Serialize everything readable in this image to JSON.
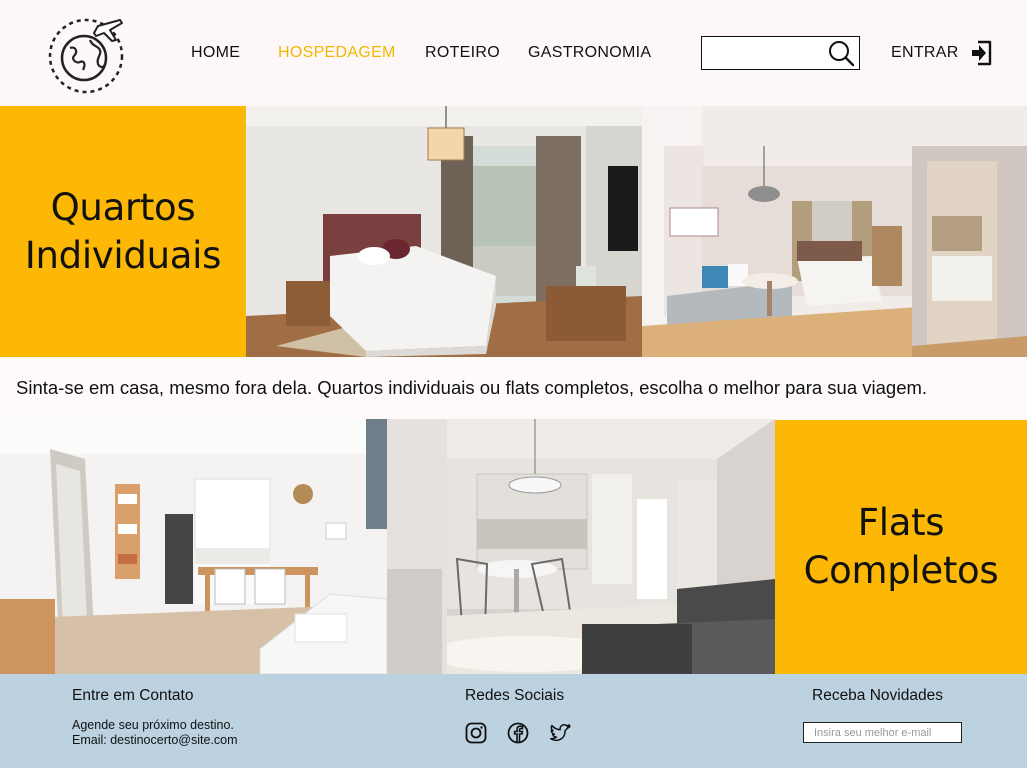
{
  "header": {
    "nav": [
      {
        "label": "HOME",
        "active": false
      },
      {
        "label": "HOSPEDAGEM",
        "active": true
      },
      {
        "label": "ROTEIRO",
        "active": false
      },
      {
        "label": "GASTRONOMIA",
        "active": false
      }
    ],
    "search": {
      "value": "",
      "placeholder": ""
    },
    "login_label": "ENTRAR"
  },
  "sections": {
    "rooms_title": "Quartos\nIndividuais",
    "tagline": "Sinta-se em casa, mesmo fora dela. Quartos individuais ou flats completos, escolha o melhor para sua viagem.",
    "flats_title": "Flats\nCompletos"
  },
  "footer": {
    "contact_title": "Entre em Contato",
    "contact_line1": "Agende seu próximo destino.",
    "contact_line2": "Email: destinocerto@site.com",
    "social_title": "Redes Sociais",
    "social_icons": [
      "instagram-icon",
      "facebook-icon",
      "twitter-icon"
    ],
    "news_title": "Receba Novidades",
    "news_placeholder": "Insira seu melhor e-mail"
  },
  "colors": {
    "accent": "#fdb805",
    "active_nav": "#f2b705",
    "footer_bg": "#bcd2e1"
  }
}
